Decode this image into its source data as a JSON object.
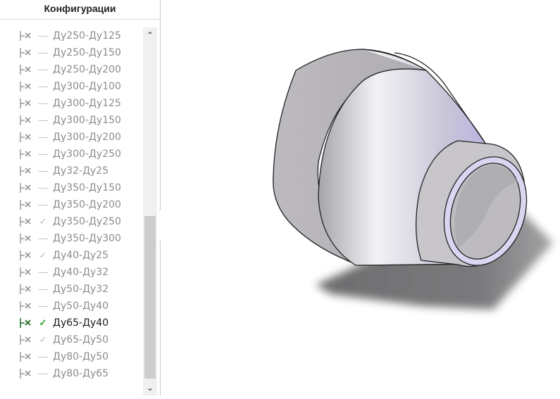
{
  "panel": {
    "title": "Конфигурации",
    "configurations": [
      {
        "label": "Ду250-Ду125",
        "state": "—",
        "active": false
      },
      {
        "label": "Ду250-Ду150",
        "state": "—",
        "active": false
      },
      {
        "label": "Ду250-Ду200",
        "state": "—",
        "active": false
      },
      {
        "label": "Ду300-Ду100",
        "state": "—",
        "active": false
      },
      {
        "label": "Ду300-Ду125",
        "state": "—",
        "active": false
      },
      {
        "label": "Ду300-Ду150",
        "state": "—",
        "active": false
      },
      {
        "label": "Ду300-Ду200",
        "state": "—",
        "active": false
      },
      {
        "label": "Ду300-Ду250",
        "state": "—",
        "active": false
      },
      {
        "label": "Ду32-Ду25",
        "state": "—",
        "active": false
      },
      {
        "label": "Ду350-Ду150",
        "state": "—",
        "active": false
      },
      {
        "label": "Ду350-Ду200",
        "state": "—",
        "active": false
      },
      {
        "label": "Ду350-Ду250",
        "state": "✓",
        "active": false
      },
      {
        "label": "Ду350-Ду300",
        "state": "—",
        "active": false
      },
      {
        "label": "Ду40-Ду25",
        "state": "✓",
        "active": false
      },
      {
        "label": "Ду40-Ду32",
        "state": "—",
        "active": false
      },
      {
        "label": "Ду50-Ду32",
        "state": "—",
        "active": false
      },
      {
        "label": "Ду50-Ду40",
        "state": "—",
        "active": false
      },
      {
        "label": "Ду65-Ду40",
        "state": "✓",
        "active": true
      },
      {
        "label": "Ду65-Ду50",
        "state": "✓",
        "active": false
      },
      {
        "label": "Ду80-Ду50",
        "state": "—",
        "active": false
      },
      {
        "label": "Ду80-Ду65",
        "state": "—",
        "active": false
      }
    ]
  },
  "scrollbar": {
    "up_glyph": "⌃",
    "down_glyph": "⌄"
  },
  "splitter": {
    "glyph": "◦"
  },
  "colors": {
    "active_check": "#2aa02a",
    "active_icon": "#1a6b1a",
    "inactive_icon": "#9a9a9a",
    "part_body": "#c9c7cb",
    "part_edge": "#222222",
    "part_rim": "#d9d6f2"
  },
  "viewport": {
    "model": "concentric-reducer"
  }
}
